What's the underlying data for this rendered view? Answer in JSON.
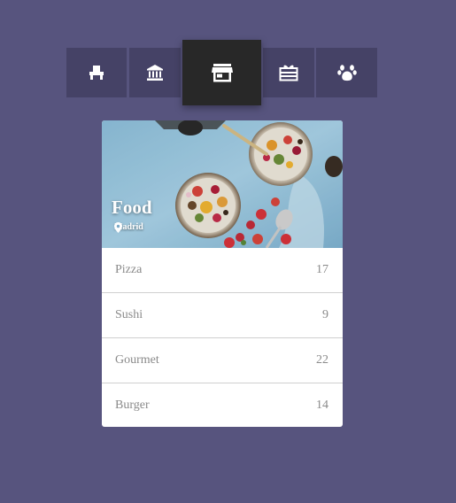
{
  "nav": {
    "tabs": [
      {
        "icon": "armchair-icon",
        "active": false
      },
      {
        "icon": "bank-icon",
        "active": false
      },
      {
        "icon": "store-icon",
        "active": true
      },
      {
        "icon": "gift-icon",
        "active": false
      },
      {
        "icon": "paw-icon",
        "active": false
      }
    ]
  },
  "card": {
    "title": "Food",
    "location": "Madrid",
    "location_icon": "map-pin-icon",
    "items": [
      {
        "label": "Pizza",
        "count": "17"
      },
      {
        "label": "Sushi",
        "count": "9"
      },
      {
        "label": "Gourmet",
        "count": "22"
      },
      {
        "label": "Burger",
        "count": "14"
      }
    ]
  },
  "colors": {
    "background": "#57547e",
    "tab": "#454266",
    "tab_active": "#282828",
    "card": "#ffffff",
    "text_muted": "#8a8a8a"
  }
}
